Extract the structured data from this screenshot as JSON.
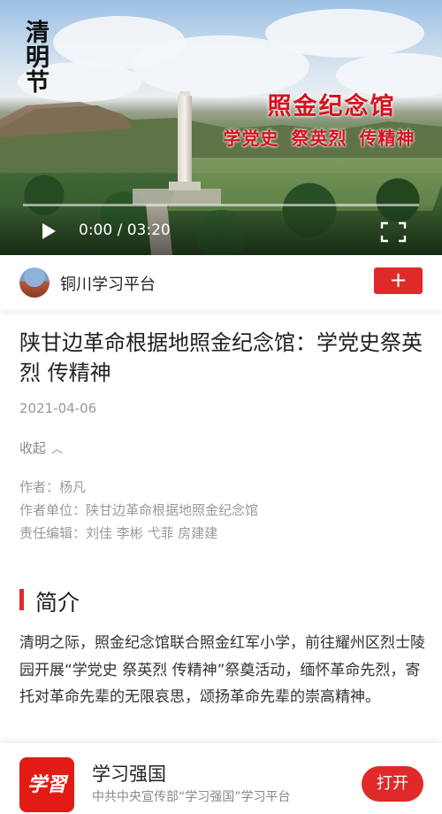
{
  "video": {
    "corner_logo": "清明节",
    "overlay_title": "照金纪念馆",
    "overlay_subtitle": "学党史 祭英烈 传精神",
    "time_display": "0:00 / 03:20",
    "progress": 0,
    "icons": {
      "play": "play-icon",
      "fullscreen": "fullscreen-icon"
    }
  },
  "source": {
    "name": "铜川学习平台",
    "follow_label": "+"
  },
  "article": {
    "title": "陕甘边革命根据地照金纪念馆：学党史祭英烈 传精神",
    "date": "2021-04-06",
    "collapse_label": "收起",
    "author": "作者：杨凡",
    "author_unit": "作者单位：陕甘边革命根据地照金纪念馆",
    "editors": "责任编辑：刘佳 李彬 弋菲 房建建",
    "section_title": "简介",
    "intro": "清明之际，照金纪念馆联合照金红军小学，前往耀州区烈士陵园开展“学党史 祭英烈 传精神”祭奠活动，缅怀革命先烈，寄托对革命先辈的无限哀思，颂扬革命先辈的崇高精神。"
  },
  "banner": {
    "logo_text": "学習",
    "app_name": "学习强国",
    "app_desc": "中共中央宣传部“学习强国”学习平台",
    "open_label": "打开"
  },
  "colors": {
    "accent": "#e02a2a",
    "overlay_text": "#d5121e",
    "logo_bg": "#e21b14"
  }
}
